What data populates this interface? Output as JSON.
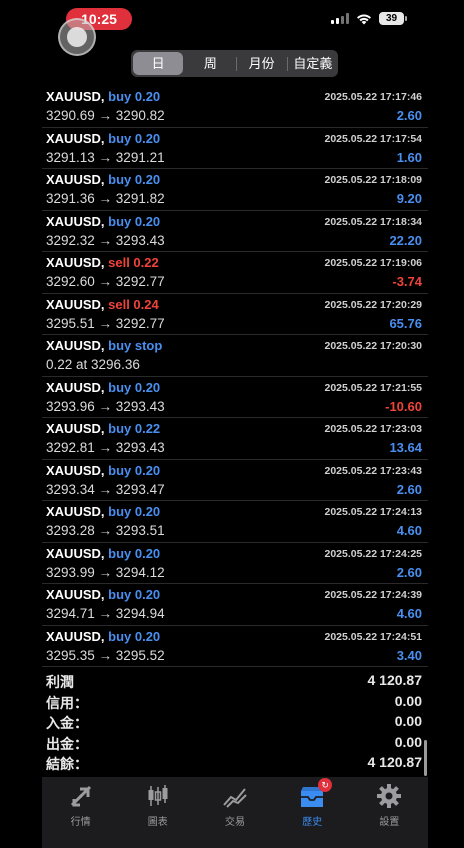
{
  "status_bar": {
    "time": "10:25",
    "battery": "39"
  },
  "segment": {
    "items": [
      "日",
      "周",
      "月份",
      "自定義"
    ],
    "selected": "日"
  },
  "deals": [
    {
      "symbol": "XAUUSD,",
      "type": "buy 0.20",
      "side": "buy",
      "prices": "3290.69 → 3290.82",
      "datetime": "2025.05.22 17:17:46",
      "profit": "2.60",
      "profit_sign": "pos"
    },
    {
      "symbol": "XAUUSD,",
      "type": "buy 0.20",
      "side": "buy",
      "prices": "3291.13 → 3291.21",
      "datetime": "2025.05.22 17:17:54",
      "profit": "1.60",
      "profit_sign": "pos"
    },
    {
      "symbol": "XAUUSD,",
      "type": "buy 0.20",
      "side": "buy",
      "prices": "3291.36 → 3291.82",
      "datetime": "2025.05.22 17:18:09",
      "profit": "9.20",
      "profit_sign": "pos"
    },
    {
      "symbol": "XAUUSD,",
      "type": "buy 0.20",
      "side": "buy",
      "prices": "3292.32 → 3293.43",
      "datetime": "2025.05.22 17:18:34",
      "profit": "22.20",
      "profit_sign": "pos"
    },
    {
      "symbol": "XAUUSD,",
      "type": "sell 0.22",
      "side": "sell",
      "prices": "3292.60 → 3292.77",
      "datetime": "2025.05.22 17:19:06",
      "profit": "-3.74",
      "profit_sign": "neg"
    },
    {
      "symbol": "XAUUSD,",
      "type": "sell 0.24",
      "side": "sell",
      "prices": "3295.51 → 3292.77",
      "datetime": "2025.05.22 17:20:29",
      "profit": "65.76",
      "profit_sign": "pos"
    },
    {
      "symbol": "XAUUSD,",
      "type": "buy stop",
      "side": "buy",
      "prices": "0.22 at 3296.36",
      "datetime": "2025.05.22 17:20:30",
      "profit": "",
      "profit_sign": "pos"
    },
    {
      "symbol": "XAUUSD,",
      "type": "buy 0.20",
      "side": "buy",
      "prices": "3293.96 → 3293.43",
      "datetime": "2025.05.22 17:21:55",
      "profit": "-10.60",
      "profit_sign": "neg"
    },
    {
      "symbol": "XAUUSD,",
      "type": "buy 0.22",
      "side": "buy",
      "prices": "3292.81 → 3293.43",
      "datetime": "2025.05.22 17:23:03",
      "profit": "13.64",
      "profit_sign": "pos"
    },
    {
      "symbol": "XAUUSD,",
      "type": "buy 0.20",
      "side": "buy",
      "prices": "3293.34 → 3293.47",
      "datetime": "2025.05.22 17:23:43",
      "profit": "2.60",
      "profit_sign": "pos"
    },
    {
      "symbol": "XAUUSD,",
      "type": "buy 0.20",
      "side": "buy",
      "prices": "3293.28 → 3293.51",
      "datetime": "2025.05.22 17:24:13",
      "profit": "4.60",
      "profit_sign": "pos"
    },
    {
      "symbol": "XAUUSD,",
      "type": "buy 0.20",
      "side": "buy",
      "prices": "3293.99 → 3294.12",
      "datetime": "2025.05.22 17:24:25",
      "profit": "2.60",
      "profit_sign": "pos"
    },
    {
      "symbol": "XAUUSD,",
      "type": "buy 0.20",
      "side": "buy",
      "prices": "3294.71 → 3294.94",
      "datetime": "2025.05.22 17:24:39",
      "profit": "4.60",
      "profit_sign": "pos"
    },
    {
      "symbol": "XAUUSD,",
      "type": "buy 0.20",
      "side": "buy",
      "prices": "3295.35 → 3295.52",
      "datetime": "2025.05.22 17:24:51",
      "profit": "3.40",
      "profit_sign": "pos"
    }
  ],
  "summary": [
    {
      "label": "利潤",
      "value": "4 120.87"
    },
    {
      "label": "信用：",
      "value": "0.00"
    },
    {
      "label": "入金：",
      "value": "0.00"
    },
    {
      "label": "出金：",
      "value": "0.00"
    },
    {
      "label": "結餘：",
      "value": "4 120.87"
    }
  ],
  "tabs": [
    {
      "label": "行情",
      "icon": "quotes-icon"
    },
    {
      "label": "圖表",
      "icon": "chart-icon"
    },
    {
      "label": "交易",
      "icon": "trade-icon"
    },
    {
      "label": "歷史",
      "icon": "history-icon",
      "badge": "↻"
    },
    {
      "label": "設置",
      "icon": "settings-icon"
    }
  ],
  "colors": {
    "buy": "#4a8ff0",
    "sell": "#f0433a",
    "active_tab": "#3a8cf0"
  }
}
